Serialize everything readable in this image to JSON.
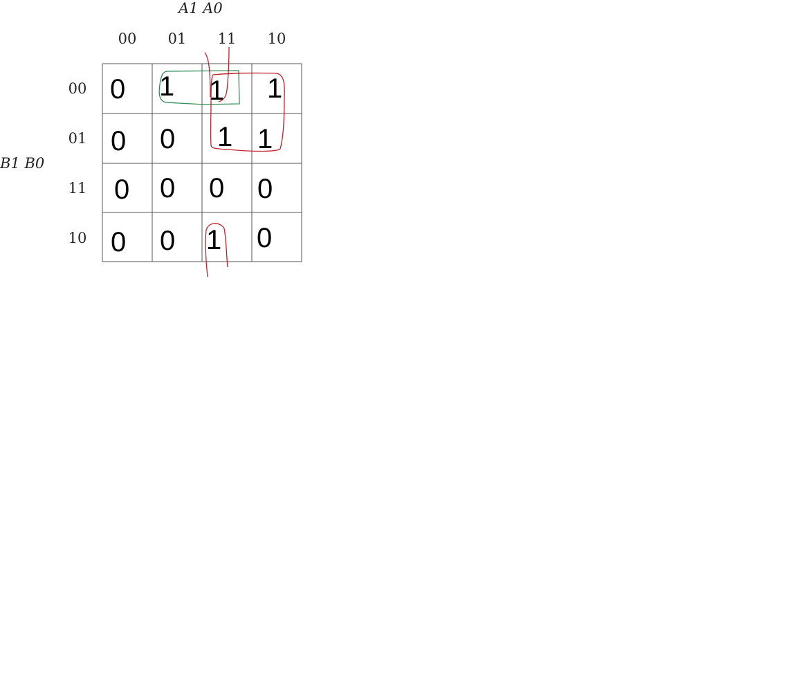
{
  "kmap": {
    "column_variables": "A1 A0",
    "row_variables": "B1 B0",
    "column_labels": [
      "00",
      "01",
      "11",
      "10"
    ],
    "row_labels": [
      "00",
      "01",
      "11",
      "10"
    ],
    "cells": [
      [
        "0",
        "1",
        "1",
        "1"
      ],
      [
        "0",
        "0",
        "1",
        "1"
      ],
      [
        "0",
        "0",
        "0",
        "0"
      ],
      [
        "0",
        "0",
        "1",
        "0"
      ]
    ]
  },
  "groupings": {
    "green_group_color": "#2e8b57",
    "red_group_color": "#c0202a",
    "grid_line_color": "#555555"
  }
}
